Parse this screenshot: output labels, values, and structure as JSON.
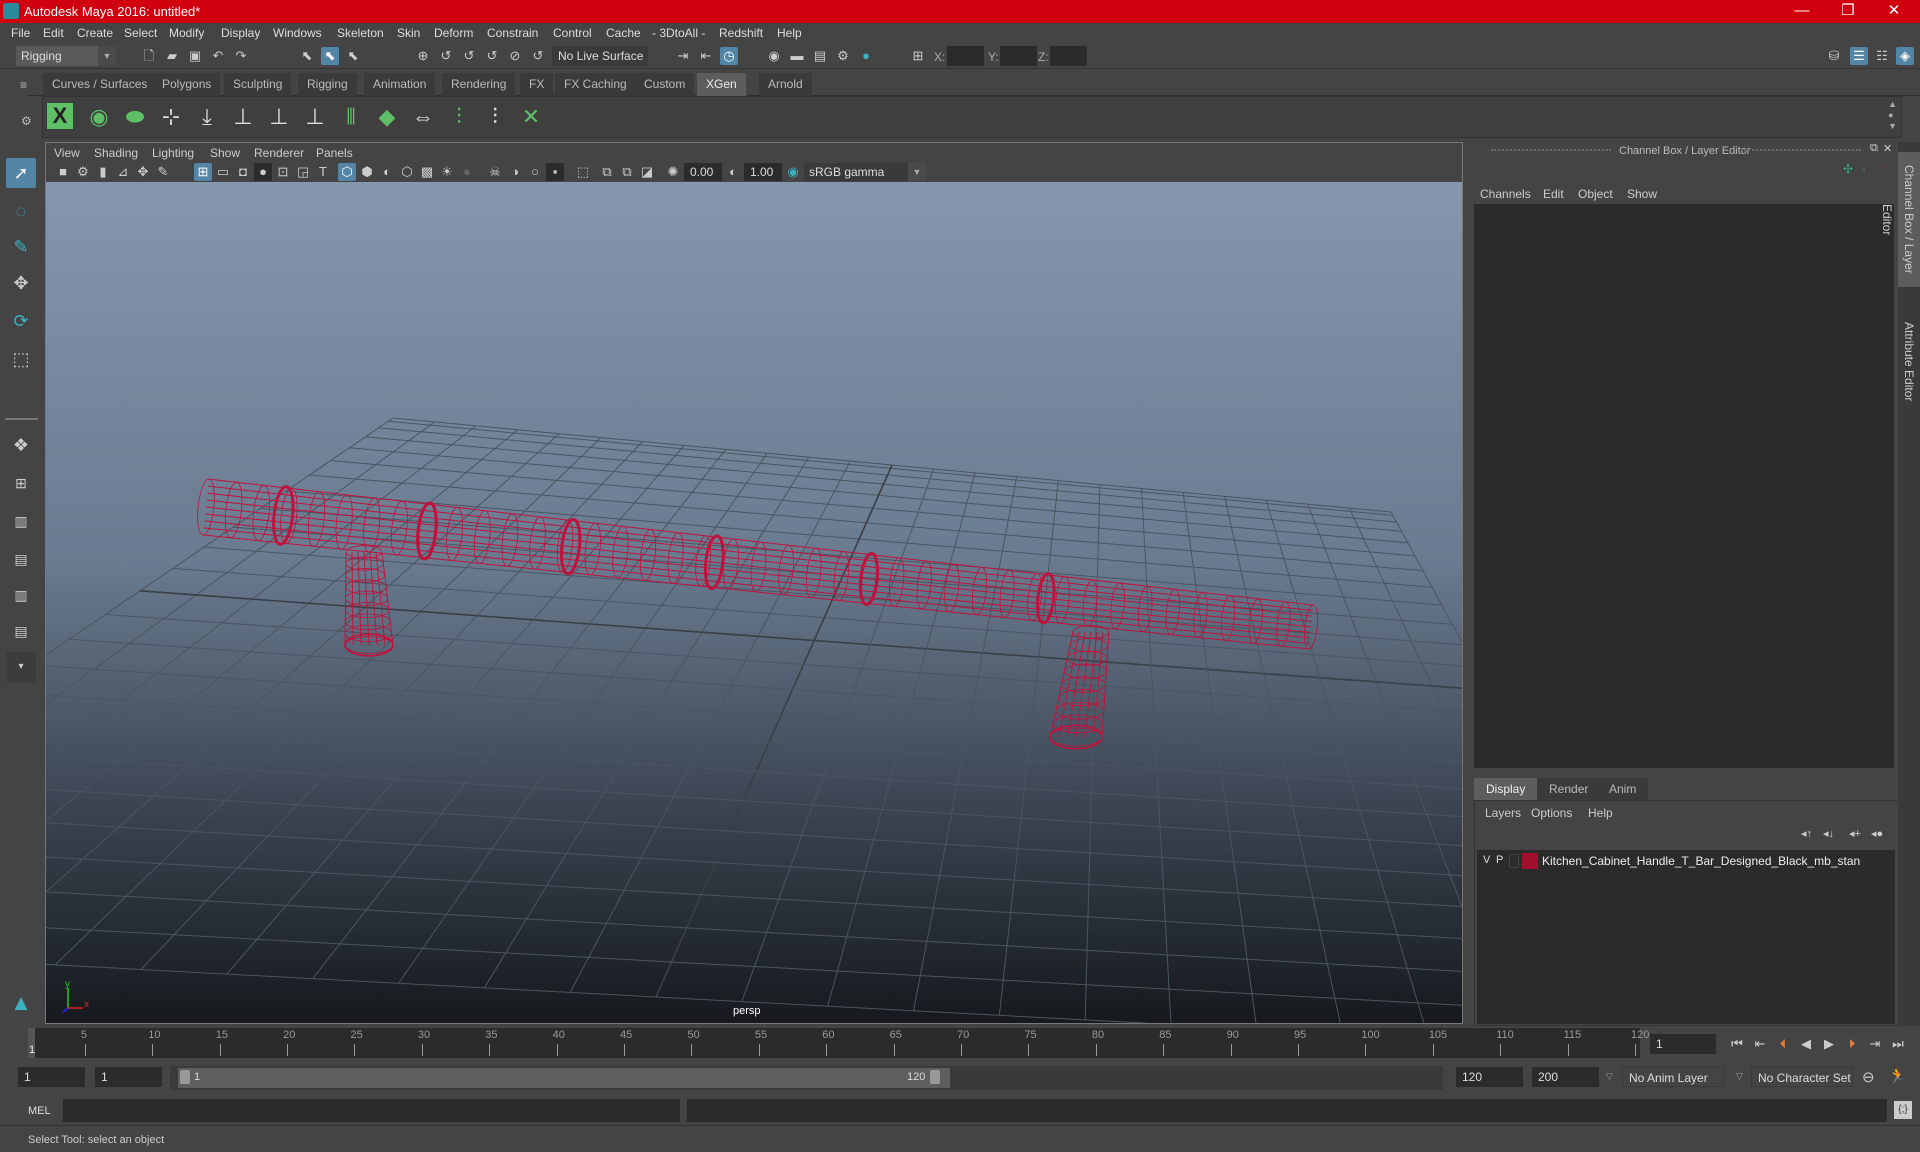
{
  "window": {
    "title": "Autodesk Maya 2016: untitled*",
    "minimize": "—",
    "restore": "❐",
    "close": "✕"
  },
  "menubar": [
    "File",
    "Edit",
    "Create",
    "Select",
    "Modify",
    "Display",
    "Windows",
    "Skeleton",
    "Skin",
    "Deform",
    "Constrain",
    "Control",
    "Cache",
    "- 3DtoAll -",
    "Redshift",
    "Help"
  ],
  "statusline": {
    "menu_set": "Rigging",
    "live_surface": "No Live Surface",
    "x_label": "X:",
    "y_label": "Y:",
    "z_label": "Z:",
    "x_value": "",
    "y_value": "",
    "z_value": ""
  },
  "shelf_tabs": [
    "Curves / Surfaces",
    "Polygons",
    "Sculpting",
    "Rigging",
    "Animation",
    "Rendering",
    "FX",
    "FX Caching",
    "Custom",
    "XGen",
    "Arnold"
  ],
  "active_shelf_tab": "XGen",
  "shelf_icons": [
    "xgen-editor",
    "preview-generate",
    "clear-preview",
    "add-guide",
    "place-guide",
    "add-splines",
    "show-guides",
    "lock-guides",
    "split-guides",
    "generate-patches",
    "modify-guides",
    "select-guides",
    "deselect-guides",
    "delete-guides"
  ],
  "viewport": {
    "menu": [
      "View",
      "Shading",
      "Lighting",
      "Show",
      "Renderer",
      "Panels"
    ],
    "exposure": "0.00",
    "gamma": "1.00",
    "color_space": "sRGB gamma",
    "camera_label": "persp",
    "axis": {
      "x": "x",
      "y": "y",
      "z": "z"
    },
    "wire_color": "#c0123c"
  },
  "channel_box": {
    "title": "Channel Box / Layer Editor",
    "menu": [
      "Channels",
      "Edit",
      "Object",
      "Show"
    ]
  },
  "layer_editor": {
    "tabs": [
      "Display",
      "Render",
      "Anim"
    ],
    "active_tab": "Display",
    "menu": [
      "Layers",
      "Options",
      "Help"
    ],
    "layers": [
      {
        "v": "V",
        "p": "P",
        "color": "#a0102e",
        "name": "Kitchen_Cabinet_Handle_T_Bar_Designed_Black_mb_stan"
      }
    ]
  },
  "side_tabs": [
    "Channel Box / Layer Editor",
    "Attribute Editor"
  ],
  "timeline": {
    "labels": [
      "5",
      "10",
      "15",
      "20",
      "25",
      "30",
      "35",
      "40",
      "45",
      "50",
      "55",
      "60",
      "65",
      "70",
      "75",
      "80",
      "85",
      "90",
      "95",
      "100",
      "105",
      "110",
      "115",
      "120"
    ],
    "current_frame_marker": "1",
    "current_frame": "1",
    "start": 1,
    "end": 120
  },
  "range": {
    "start_time": "1",
    "playback_start": "1",
    "slider_start": "1",
    "slider_end": "120",
    "playback_end": "120",
    "end_time": "200",
    "anim_layer": "No Anim Layer",
    "character_set": "No Character Set"
  },
  "command": {
    "lang": "MEL",
    "input": "",
    "output": ""
  },
  "help_line": "Select Tool: select an object"
}
